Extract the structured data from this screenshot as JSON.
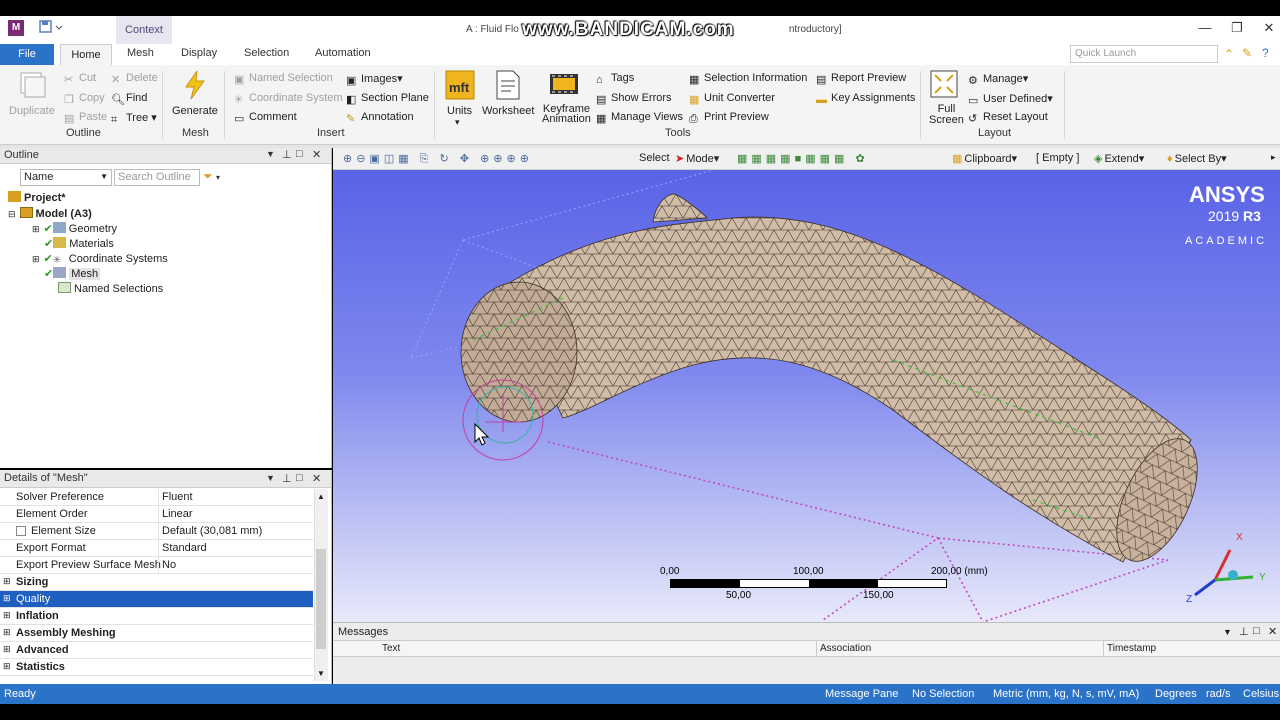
{
  "window": {
    "title": "A : Fluid Flow (Fluent) - Meshing [ANSYS Academic Introductory]",
    "title_left": "A : Fluid Flo",
    "title_right": "ntroductory]",
    "watermark": "www.BANDICAM.com",
    "context_tab": "Context",
    "app_icon": "M"
  },
  "tabs": {
    "file": "File",
    "home": "Home",
    "mesh": "Mesh",
    "display": "Display",
    "selection": "Selection",
    "automation": "Automation"
  },
  "quick_launch": {
    "placeholder": "Quick Launch"
  },
  "ribbon": {
    "outline": {
      "group": "Outline",
      "duplicate": "Duplicate",
      "cut": "Cut",
      "copy": "Copy",
      "paste": "Paste",
      "delete": "Delete",
      "find": "Find",
      "tree": "Tree"
    },
    "mesh": {
      "group": "Mesh",
      "generate": "Generate"
    },
    "insert": {
      "group": "Insert",
      "named_selection": "Named Selection",
      "coordinate_system": "Coordinate System",
      "comment": "Comment",
      "images": "Images",
      "section_plane": "Section Plane",
      "annotation": "Annotation"
    },
    "tools": {
      "group": "Tools",
      "units": "Units",
      "worksheet": "Worksheet",
      "keyframe": "Keyframe",
      "animation": "Animation",
      "tags": "Tags",
      "show_errors": "Show Errors",
      "manage_views": "Manage Views",
      "selection_information": "Selection Information",
      "unit_converter": "Unit Converter",
      "print_preview": "Print Preview",
      "report_preview": "Report Preview",
      "key_assignments": "Key Assignments"
    },
    "layout": {
      "group": "Layout",
      "full": "Full",
      "screen": "Screen",
      "manage": "Manage",
      "user_defined": "User Defined",
      "reset_layout": "Reset Layout"
    }
  },
  "outline": {
    "title": "Outline",
    "filter": "Name",
    "search_placeholder": "Search Outline",
    "tree": {
      "project": "Project*",
      "model": "Model (A3)",
      "geometry": "Geometry",
      "materials": "Materials",
      "coordinate_systems": "Coordinate Systems",
      "mesh": "Mesh",
      "named_selections": "Named Selections"
    }
  },
  "details": {
    "title": "Details of \"Mesh\"",
    "rows": [
      {
        "key": "Solver Preference",
        "value": "Fluent"
      },
      {
        "key": "Element Order",
        "value": "Linear"
      },
      {
        "key": "Element Size",
        "value": "Default (30,081 mm)"
      },
      {
        "key": "Export Format",
        "value": "Standard"
      },
      {
        "key": "Export Preview Surface Mesh",
        "value": "No"
      }
    ],
    "categories": [
      "Sizing",
      "Quality",
      "Inflation",
      "Assembly Meshing",
      "Advanced",
      "Statistics"
    ],
    "selected": "Quality"
  },
  "view_toolbar": {
    "select": "Select",
    "mode": "Mode",
    "clipboard": "Clipboard",
    "empty": "[ Empty ]",
    "extend": "Extend",
    "select_by": "Select By"
  },
  "logo": {
    "brand": "ANSYS",
    "version": "2019",
    "release": "R3",
    "edition": "ACADEMIC"
  },
  "scale": {
    "l0": "0,00",
    "l100": "100,00",
    "l200": "200,00 (mm)",
    "l50": "50,00",
    "l150": "150,00"
  },
  "triad": {
    "x": "X",
    "y": "Y",
    "z": "Z"
  },
  "messages": {
    "title": "Messages",
    "col_text": "Text",
    "col_association": "Association",
    "col_timestamp": "Timestamp"
  },
  "status": {
    "ready": "Ready",
    "message_pane": "Message Pane",
    "no_selection": "No Selection",
    "units": "Metric (mm, kg, N, s, mV, mA)",
    "degrees": "Degrees",
    "rads": "rad/s",
    "celsius": "Celsius"
  },
  "colors": {
    "accent": "#2b73c9",
    "quality_highlight": "#1f5fbf",
    "viewport_top": "#5963e6",
    "mesh_fill": "#d1bca8"
  }
}
